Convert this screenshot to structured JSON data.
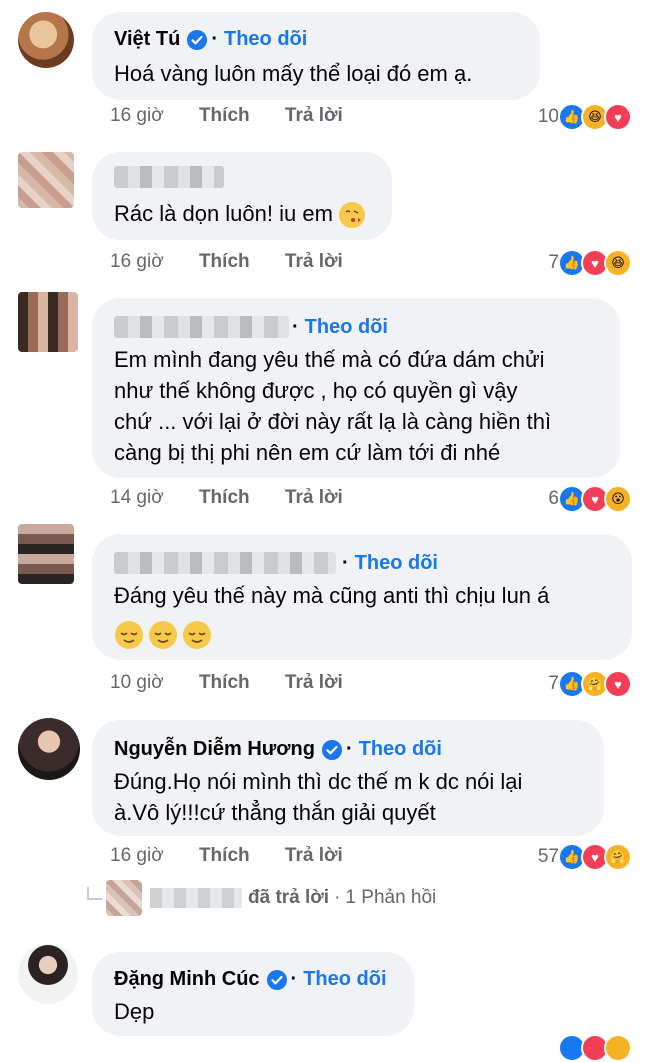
{
  "comments": [
    {
      "name": "Việt Tú",
      "follow": "Theo dõi",
      "lines": [
        "Hoá vàng luôn mấy thể loại đó em ạ."
      ],
      "time": "16 giờ",
      "like": "Thích",
      "reply": "Trả lời",
      "count": "10"
    },
    {
      "name": "",
      "lines": [
        "Rác là dọn luôn! iu em"
      ],
      "time": "16 giờ",
      "like": "Thích",
      "reply": "Trả lời",
      "count": "7"
    },
    {
      "name": "",
      "follow": "Theo dõi",
      "lines": [
        "Em mình đang yêu thế mà có đứa dám chửi",
        "như thế không được , họ có quyền gì vậy",
        "chứ ... với lại ở đời này rất lạ là càng hiền thì",
        "càng bị thị phi nên em cứ làm tới đi nhé"
      ],
      "time": "14 giờ",
      "like": "Thích",
      "reply": "Trả lời",
      "count": "6"
    },
    {
      "name": "",
      "follow": "Theo dõi",
      "lines": [
        "Đáng yêu thế này mà cũng anti thì chịu lun á"
      ],
      "time": "10 giờ",
      "like": "Thích",
      "reply": "Trả lời",
      "count": "7"
    },
    {
      "name": "Nguyễn Diễm Hương",
      "follow": "Theo dõi",
      "lines": [
        "Đúng.Họ nói mình thì dc thế m k dc nói lại",
        "à.Vô lý!!!cứ thẳng thắn giải quyết"
      ],
      "time": "16 giờ",
      "like": "Thích",
      "reply": "Trả lời",
      "count": "57"
    },
    {
      "name": "Đặng Minh Cúc",
      "follow": "Theo dõi",
      "lines": [
        "Dẹp"
      ]
    }
  ],
  "reply_summary": {
    "replied": "đã trả lời",
    "separator": "·",
    "count_label": "1 Phản hồi"
  },
  "colors": {
    "accent": "#1877f2",
    "bubble": "#f0f2f5",
    "meta": "#65676b",
    "love": "#f33e58",
    "haha": "#f7b125"
  }
}
